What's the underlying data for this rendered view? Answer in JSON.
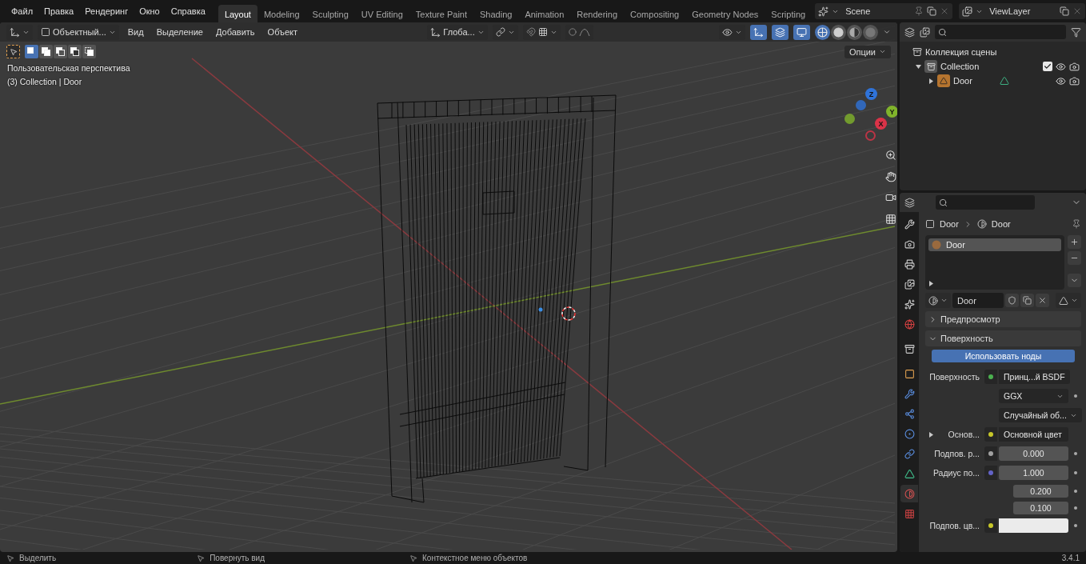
{
  "menu": [
    "Файл",
    "Правка",
    "Рендеринг",
    "Окно",
    "Справка"
  ],
  "workspaces": [
    {
      "label": "Layout",
      "selected": true
    },
    {
      "label": "Modeling",
      "selected": false
    },
    {
      "label": "Sculpting",
      "selected": false
    },
    {
      "label": "UV Editing",
      "selected": false
    },
    {
      "label": "Texture Paint",
      "selected": false
    },
    {
      "label": "Shading",
      "selected": false
    },
    {
      "label": "Animation",
      "selected": false
    },
    {
      "label": "Rendering",
      "selected": false
    },
    {
      "label": "Compositing",
      "selected": false
    },
    {
      "label": "Geometry Nodes",
      "selected": false
    },
    {
      "label": "Scripting",
      "selected": false
    }
  ],
  "scene": {
    "name": "Scene"
  },
  "view_layer": {
    "name": "ViewLayer"
  },
  "viewport": {
    "mode": "Объектный...",
    "menus": [
      "Вид",
      "Выделение",
      "Добавить",
      "Объект"
    ],
    "orientation": "Глоба...",
    "gizmos_on": true,
    "overlays_on": true,
    "xray_on": true,
    "shading_modes": [
      {
        "kind": "wireframe",
        "selected": true
      },
      {
        "kind": "solid",
        "selected": false
      },
      {
        "kind": "material",
        "selected": false
      },
      {
        "kind": "rendered",
        "selected": false
      }
    ],
    "select_modes": [
      {
        "kind": "set",
        "selected": true
      },
      {
        "kind": "extend",
        "selected": false
      },
      {
        "kind": "subtract",
        "selected": false
      },
      {
        "kind": "difference",
        "selected": false
      },
      {
        "kind": "intersect",
        "selected": false
      }
    ],
    "options": "Опции",
    "overlay_text": [
      "Пользовательская перспектива",
      "(3) Collection | Door"
    ],
    "gizmo_axes": [
      {
        "label": "Z",
        "color": "#2f73d9"
      },
      {
        "label": "Y",
        "color": "#80b32b"
      },
      {
        "label": "X",
        "color": "#db3348"
      }
    ]
  },
  "outliner": {
    "root": "Коллекция сцены",
    "children": [
      {
        "label": "Collection",
        "kind": "collection",
        "expanded": true,
        "checked": true,
        "children": [
          {
            "label": "Door",
            "kind": "mesh",
            "expanded": false
          }
        ]
      }
    ]
  },
  "properties": {
    "tabs": [
      {
        "kind": "tool",
        "selected": false
      },
      {
        "kind": "render",
        "selected": false
      },
      {
        "kind": "output",
        "selected": false
      },
      {
        "kind": "view_layer",
        "selected": false
      },
      {
        "kind": "scene",
        "selected": false
      },
      {
        "kind": "world",
        "selected": false
      },
      {
        "kind": "collection",
        "selected": false
      },
      {
        "kind": "object",
        "selected": false
      },
      {
        "kind": "modifiers",
        "selected": false
      },
      {
        "kind": "particles",
        "selected": false
      },
      {
        "kind": "physics",
        "selected": false
      },
      {
        "kind": "constraints",
        "selected": false
      },
      {
        "kind": "data",
        "selected": false
      },
      {
        "kind": "material",
        "selected": true
      },
      {
        "kind": "texture",
        "selected": false
      }
    ],
    "breadcrumb": [
      "Door",
      "Door"
    ],
    "material_slots": [
      {
        "name": "Door",
        "selected": true
      }
    ],
    "slot_list_expanded": false,
    "material_name": "Door",
    "panels": [
      {
        "label": "Предпросмотр",
        "expanded": false
      },
      {
        "label": "Поверхность",
        "expanded": true
      }
    ],
    "use_nodes_button": "Использовать ноды",
    "rows": [
      {
        "kind": "socket",
        "label": "Поверхность",
        "socket": {
          "color": "#4bb04f"
        },
        "value": "Принц...й BSDF"
      },
      {
        "kind": "dropdown",
        "value": "GGX"
      },
      {
        "kind": "dropdown",
        "value": "Случайный об..."
      },
      {
        "kind": "socket",
        "label": "Основ...",
        "socket": {
          "color": "#c7c729"
        },
        "value": "Основной цвет",
        "expanded": false
      },
      {
        "kind": "number",
        "label": "Подпов. р...",
        "socket": {
          "color": "#a1a1a1"
        },
        "value": "0.000"
      },
      {
        "kind": "number",
        "label": "Радиус по...",
        "socket": {
          "color": "#6363c7"
        },
        "value": "1.000"
      },
      {
        "kind": "number",
        "value": "0.200"
      },
      {
        "kind": "number",
        "value": "0.100"
      },
      {
        "kind": "swatch",
        "label": "Подпов. цв...",
        "socket": {
          "color": "#c7c729"
        },
        "swatch": {
          "color": "#ebebeb"
        }
      }
    ]
  },
  "status_bar": {
    "items": [
      "Выделить",
      "Повернуть вид",
      "Контекстное меню объектов"
    ],
    "version": "3.4.1"
  }
}
